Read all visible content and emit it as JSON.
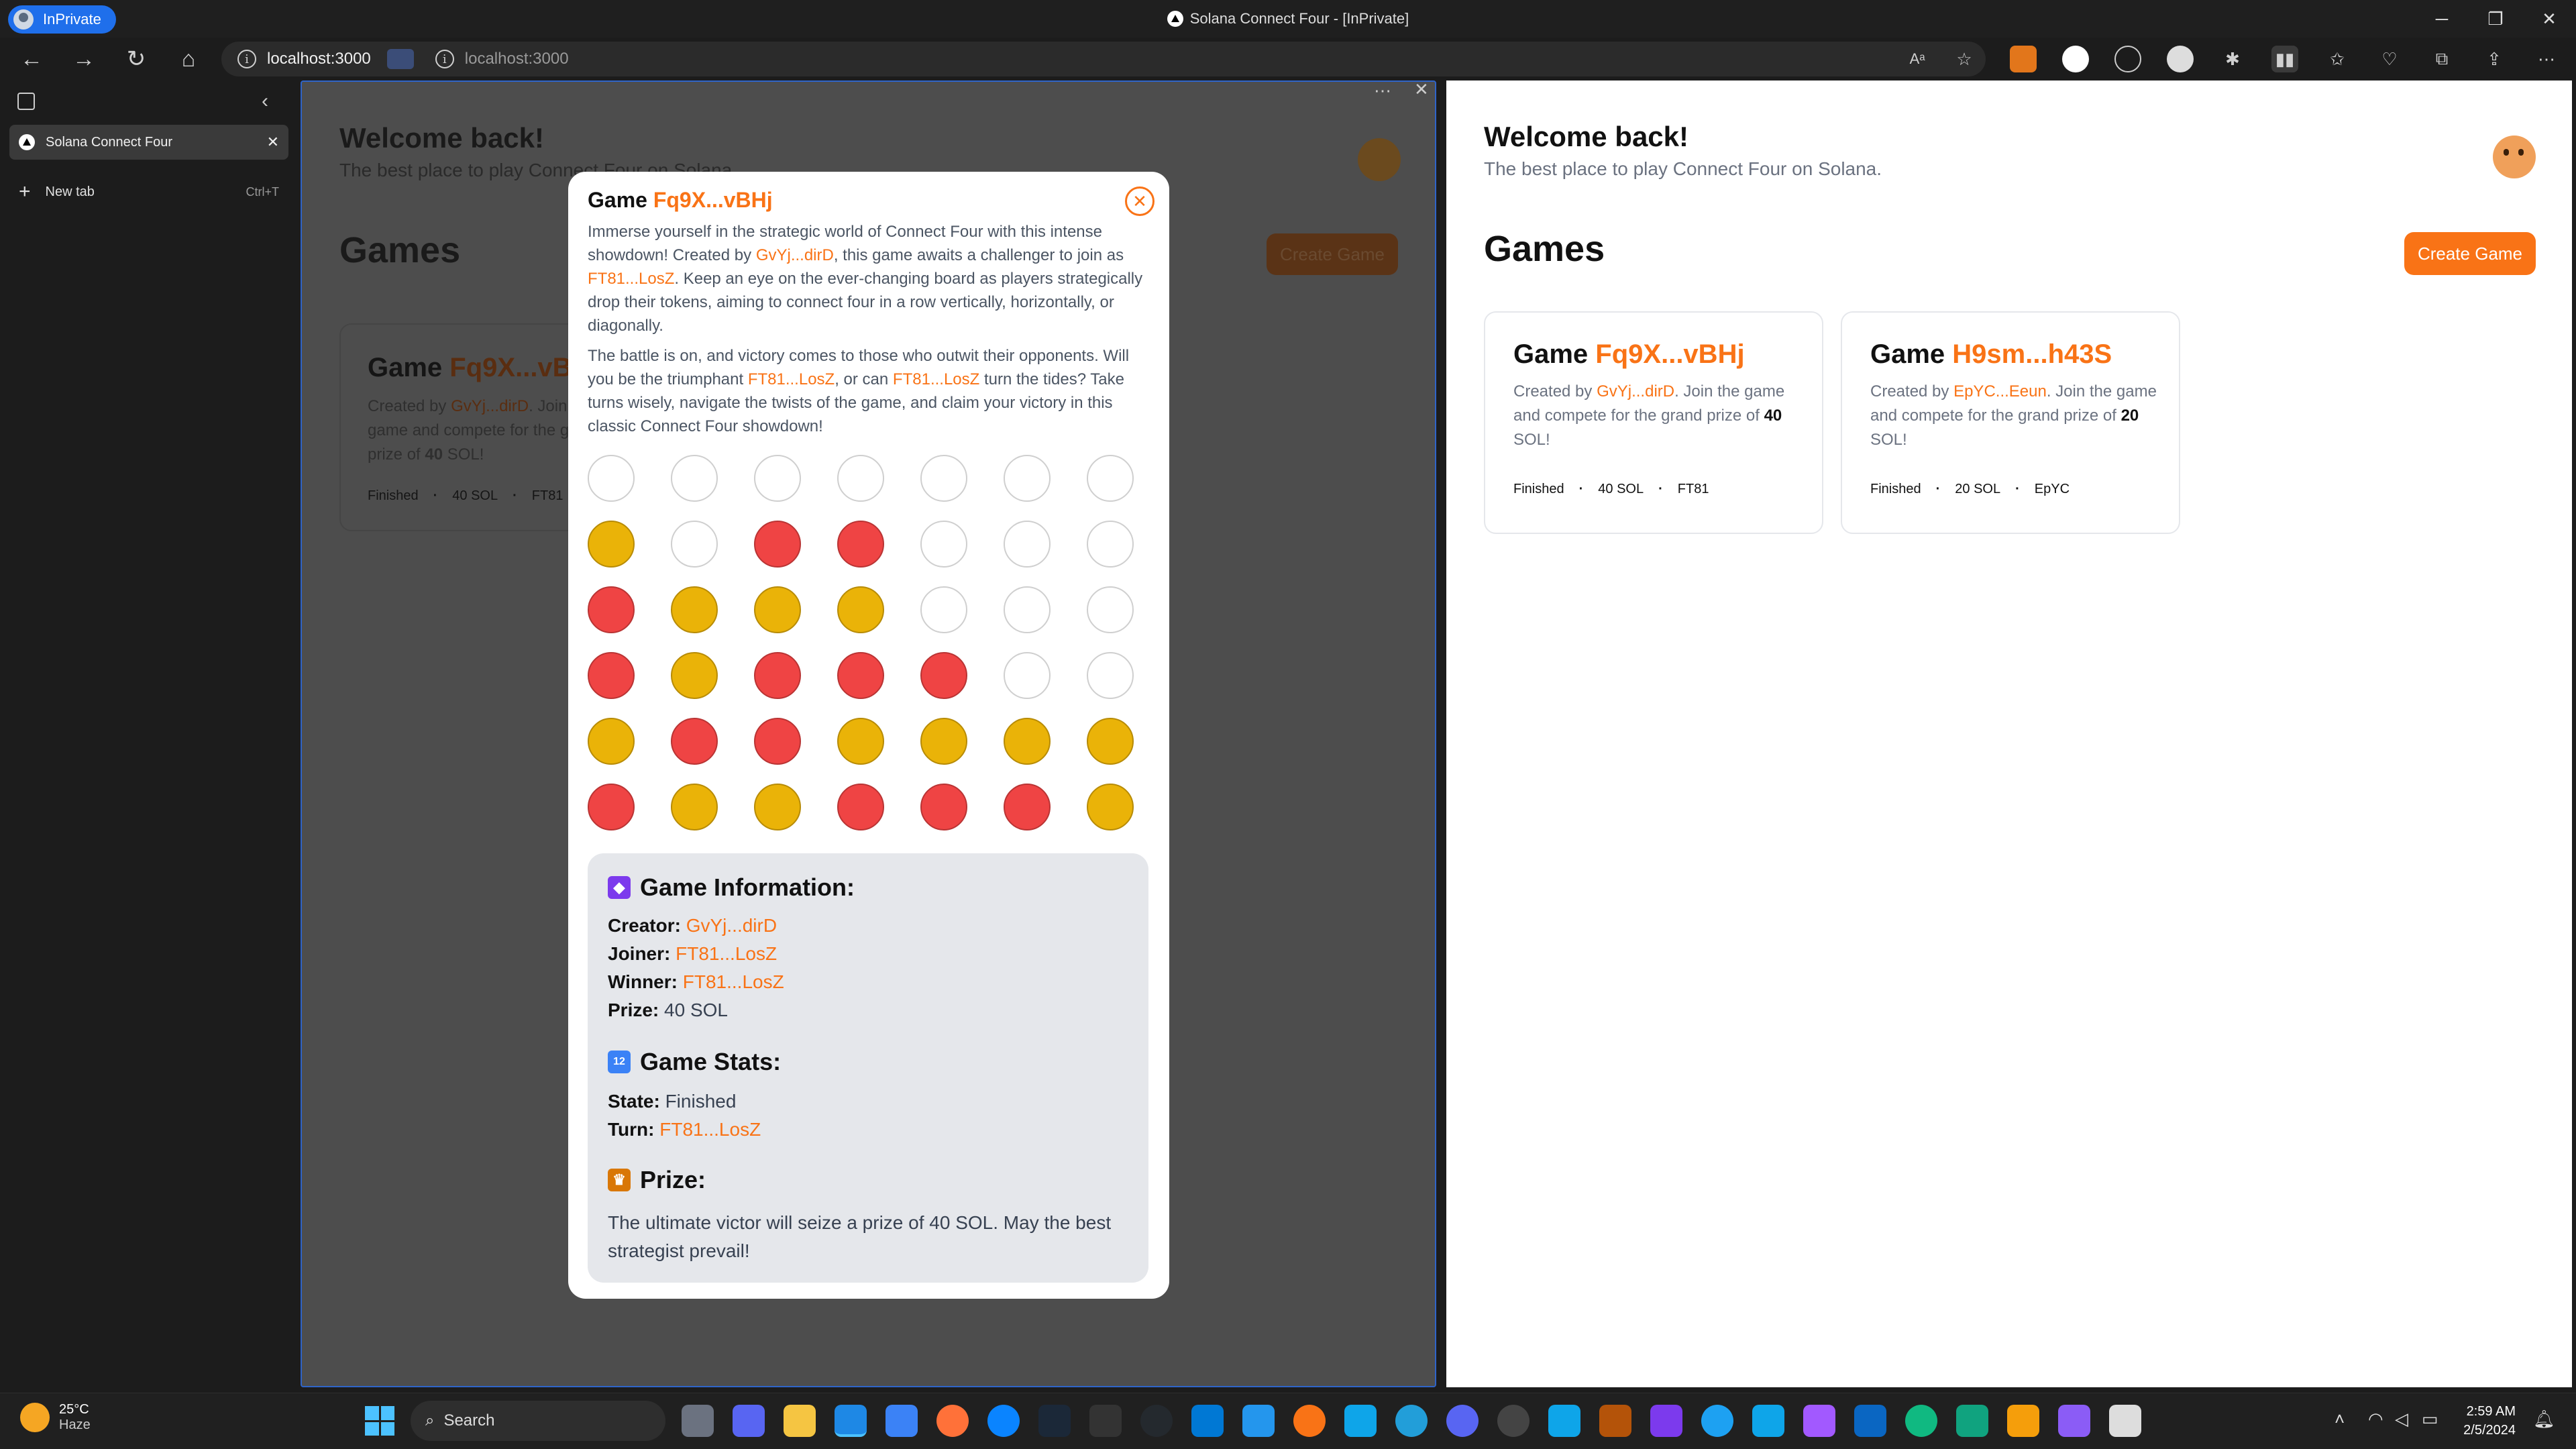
{
  "browser": {
    "inprivate_label": "InPrivate",
    "window_title": "Solana Connect Four - [InPrivate]",
    "address": "localhost:3000",
    "split_address": "localhost:3000",
    "tab_title": "Solana Connect Four",
    "new_tab_label": "New tab",
    "new_tab_shortcut": "Ctrl+T"
  },
  "page": {
    "welcome": "Welcome back!",
    "subtitle": "The best place to play Connect Four on Solana.",
    "games_heading": "Games",
    "create_button": "Create Game"
  },
  "games": [
    {
      "prefix": "Game ",
      "id": "Fq9X...vBHj",
      "desc_pre": "Created by ",
      "creator": "GvYj...dirD",
      "desc_mid": ". Join the game and compete for the grand prize of ",
      "prize": "40",
      "desc_post": " SOL!",
      "state": "Finished",
      "amount": "40 SOL",
      "winner_short": "FT81"
    },
    {
      "prefix": "Game ",
      "id": "H9sm...h43S",
      "desc_pre": "Created by ",
      "creator": "EpYC...Eeun",
      "desc_mid": ". Join the game and compete for the grand prize of ",
      "prize": "20",
      "desc_post": " SOL!",
      "state": "Finished",
      "amount": "20 SOL",
      "winner_short": "EpYC"
    }
  ],
  "modal": {
    "title_prefix": "Game ",
    "title_id": "Fq9X...vBHj",
    "p1_a": "Immerse yourself in the strategic world of Connect Four with this intense showdown! Created by ",
    "p1_creator": "GvYj...dirD",
    "p1_b": ", this game awaits a challenger to join as ",
    "p1_joiner": "FT81...LosZ",
    "p1_c": ". Keep an eye on the ever-changing board as players strategically drop their tokens, aiming to connect four in a row vertically, horizontally, or diagonally.",
    "p2_a": "The battle is on, and victory comes to those who outwit their opponents. Will you be the triumphant ",
    "p2_player1": "FT81...LosZ",
    "p2_b": ", or can ",
    "p2_player2": "FT81...LosZ",
    "p2_c": " turn the tides? Take turns wisely, navigate the twists of the game, and claim your victory in this classic Connect Four showdown!",
    "board": [
      [
        "e",
        "e",
        "e",
        "e",
        "e",
        "e",
        "e"
      ],
      [
        "y",
        "e",
        "r",
        "r",
        "e",
        "e",
        "e"
      ],
      [
        "r",
        "y",
        "y",
        "y",
        "e",
        "e",
        "e"
      ],
      [
        "r",
        "y",
        "r",
        "r",
        "r",
        "e",
        "e"
      ],
      [
        "y",
        "r",
        "r",
        "y",
        "y",
        "y",
        "y"
      ],
      [
        "r",
        "y",
        "y",
        "r",
        "r",
        "r",
        "y"
      ]
    ],
    "info_heading": "Game Information:",
    "creator_label": "Creator:",
    "creator": "GvYj...dirD",
    "joiner_label": "Joiner:",
    "joiner": "FT81...LosZ",
    "winner_label": "Winner:",
    "winner": "FT81...LosZ",
    "prize_label": "Prize:",
    "prize": "40 SOL",
    "stats_heading": "Game Stats:",
    "state_label": "State:",
    "state": "Finished",
    "turn_label": "Turn:",
    "turn": "FT81...LosZ",
    "prize_heading": "Prize:",
    "prize_text": "The ultimate victor will seize a prize of 40 SOL. May the best strategist prevail!"
  },
  "taskbar": {
    "temp": "25°C",
    "condition": "Haze",
    "search_placeholder": "Search",
    "time": "2:59 AM",
    "date": "2/5/2024"
  },
  "colors": {
    "accent": "#f97316",
    "red_token": "#ef4444",
    "yellow_token": "#eab308"
  }
}
